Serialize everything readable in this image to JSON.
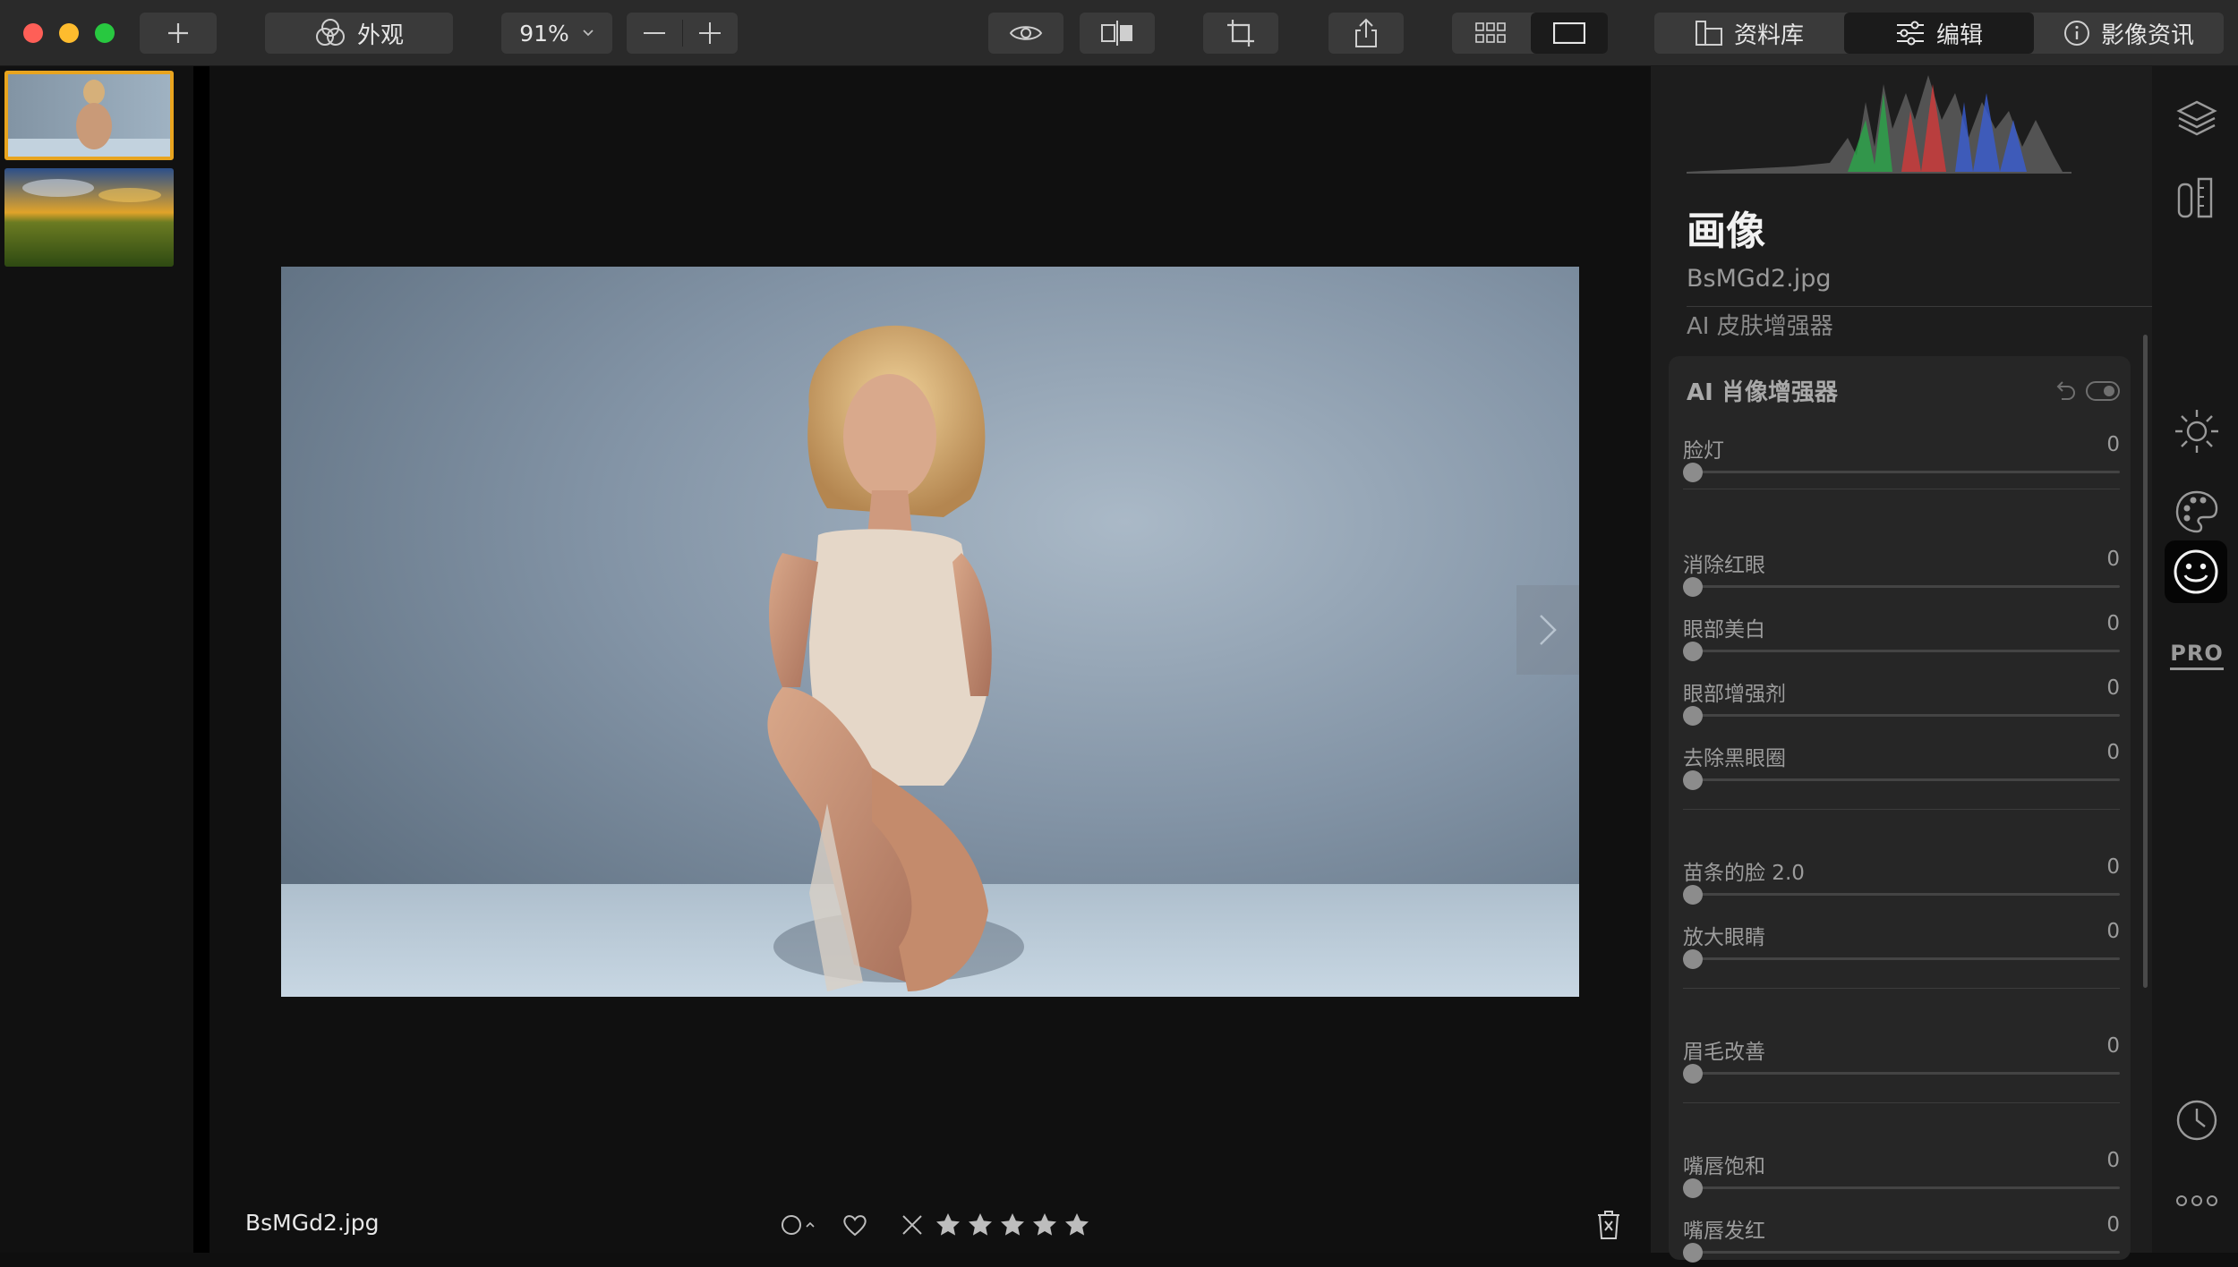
{
  "toolbar": {
    "appearance_label": "外观",
    "zoom_value": "91%",
    "tabs": [
      {
        "label": "资料库",
        "icon": "library-icon"
      },
      {
        "label": "编辑",
        "icon": "sliders-icon",
        "active": true
      },
      {
        "label": "影像资讯",
        "icon": "info-icon"
      }
    ]
  },
  "filmstrip": {
    "items": [
      {
        "name": "portrait",
        "selected": true
      },
      {
        "name": "landscape",
        "selected": false
      }
    ]
  },
  "canvas": {
    "filename": "BsMGd2.jpg",
    "rating_stars": 0,
    "colors": {
      "selection": "#e8a41e",
      "background": "#101010"
    }
  },
  "panel": {
    "title": "画像",
    "filename": "BsMGd2.jpg",
    "previous_section": "AI 皮肤增强器",
    "card": {
      "title": "AI 肖像增强器",
      "sliders": [
        {
          "label": "脸灯",
          "value": "0"
        },
        {
          "label": "消除红眼",
          "value": "0"
        },
        {
          "label": "眼部美白",
          "value": "0"
        },
        {
          "label": "眼部增强剂",
          "value": "0"
        },
        {
          "label": "去除黑眼圈",
          "value": "0"
        },
        {
          "label": "苗条的脸 2.0",
          "value": "0"
        },
        {
          "label": "放大眼睛",
          "value": "0"
        },
        {
          "label": "眉毛改善",
          "value": "0"
        },
        {
          "label": "嘴唇饱和",
          "value": "0"
        },
        {
          "label": "嘴唇发红",
          "value": "0"
        }
      ]
    }
  },
  "rail": {
    "icons": [
      "layers-icon",
      "compare-icon",
      "sun-icon",
      "palette-icon",
      "face-icon",
      "pro-icon",
      "history-icon",
      "more-icon"
    ],
    "pro_label": "PRO"
  }
}
